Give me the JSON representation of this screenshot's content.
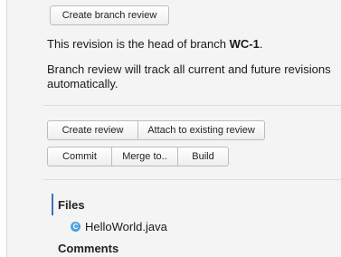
{
  "branch_review": {
    "create_branch_review_label": "Create branch review",
    "head_text_prefix": "This revision is the head of branch ",
    "branch_name": "WC-1",
    "head_text_suffix": ".",
    "tracking_text": "Branch review will track all current and future revisions automatically."
  },
  "review_actions": {
    "create_review_label": "Create review",
    "attach_label": "Attach to existing review"
  },
  "vcs_actions": {
    "commit_label": "Commit",
    "merge_label": "Merge to..",
    "build_label": "Build"
  },
  "files": {
    "heading": "Files",
    "items": [
      {
        "name": "HelloWorld.java",
        "icon": "c-class-icon",
        "icon_glyph": "C"
      }
    ]
  },
  "comments": {
    "heading": "Comments"
  },
  "colors": {
    "accent": "#3b73b9",
    "file_icon": "#4da3e0",
    "panel_bg": "#f4f4f4"
  }
}
